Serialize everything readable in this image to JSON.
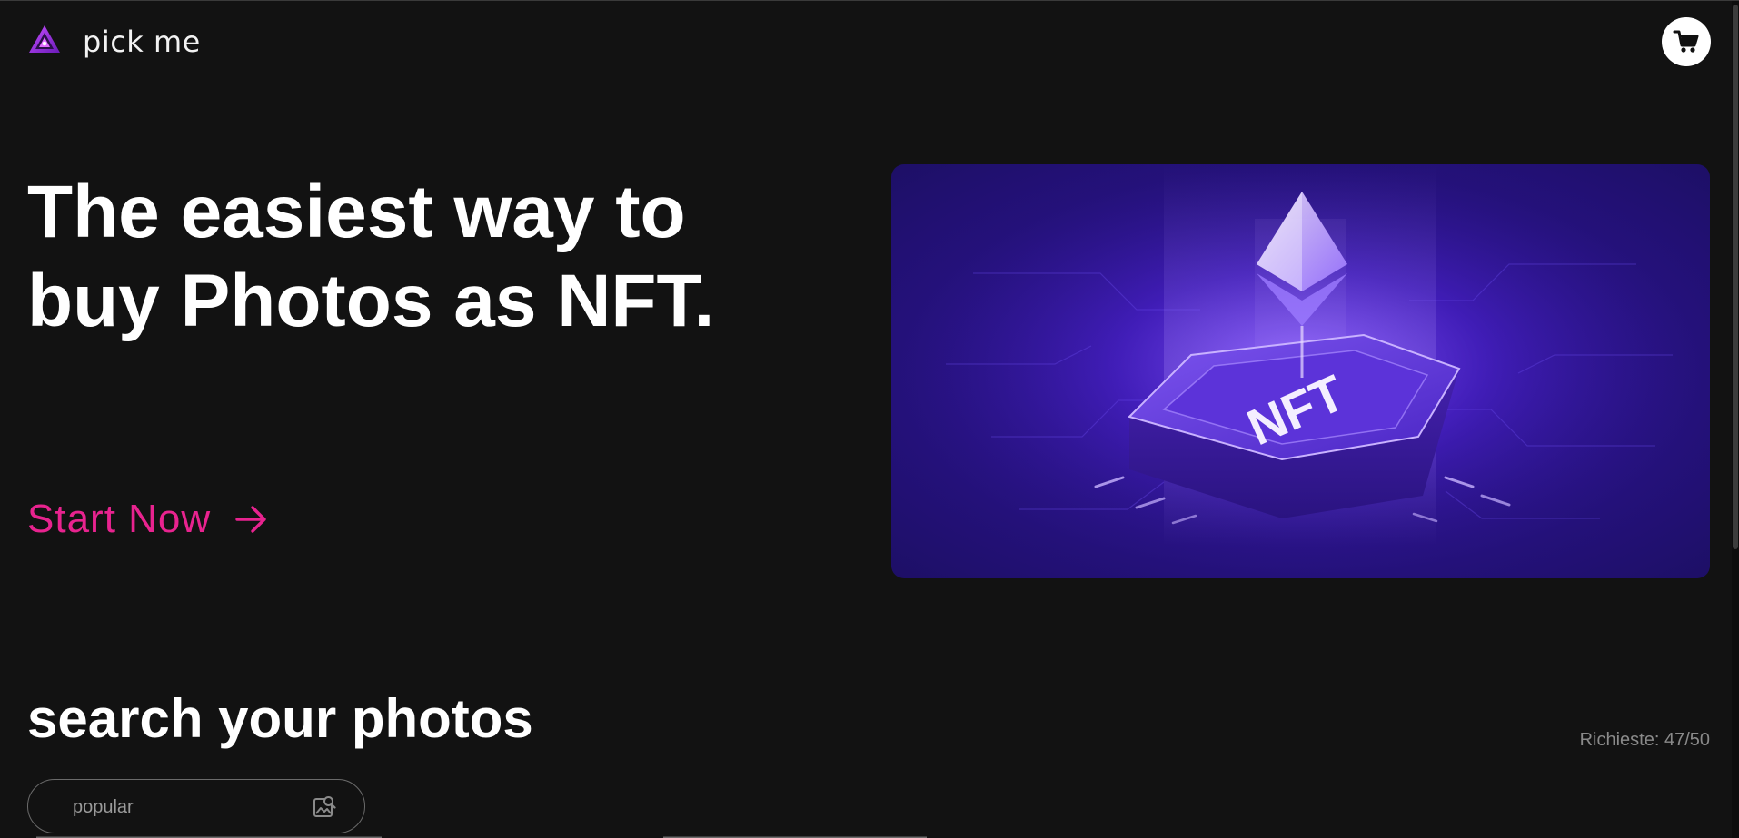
{
  "header": {
    "brand_name": "pick me",
    "logo_icon": "triangle-logo-icon",
    "cart_icon": "cart-icon"
  },
  "hero": {
    "title": "The easiest way to buy Photos as NFT.",
    "cta_label": "Start Now",
    "cta_icon": "arrow-right-icon",
    "image_text": "NFT"
  },
  "search": {
    "title": "search your photos",
    "requests_text": "Richieste: 47/50",
    "input_value": "",
    "input_placeholder": "popular",
    "icon": "image-search-icon"
  },
  "colors": {
    "background": "#121212",
    "accent": "#e8238f",
    "hero_image_base": "#2a138a"
  }
}
